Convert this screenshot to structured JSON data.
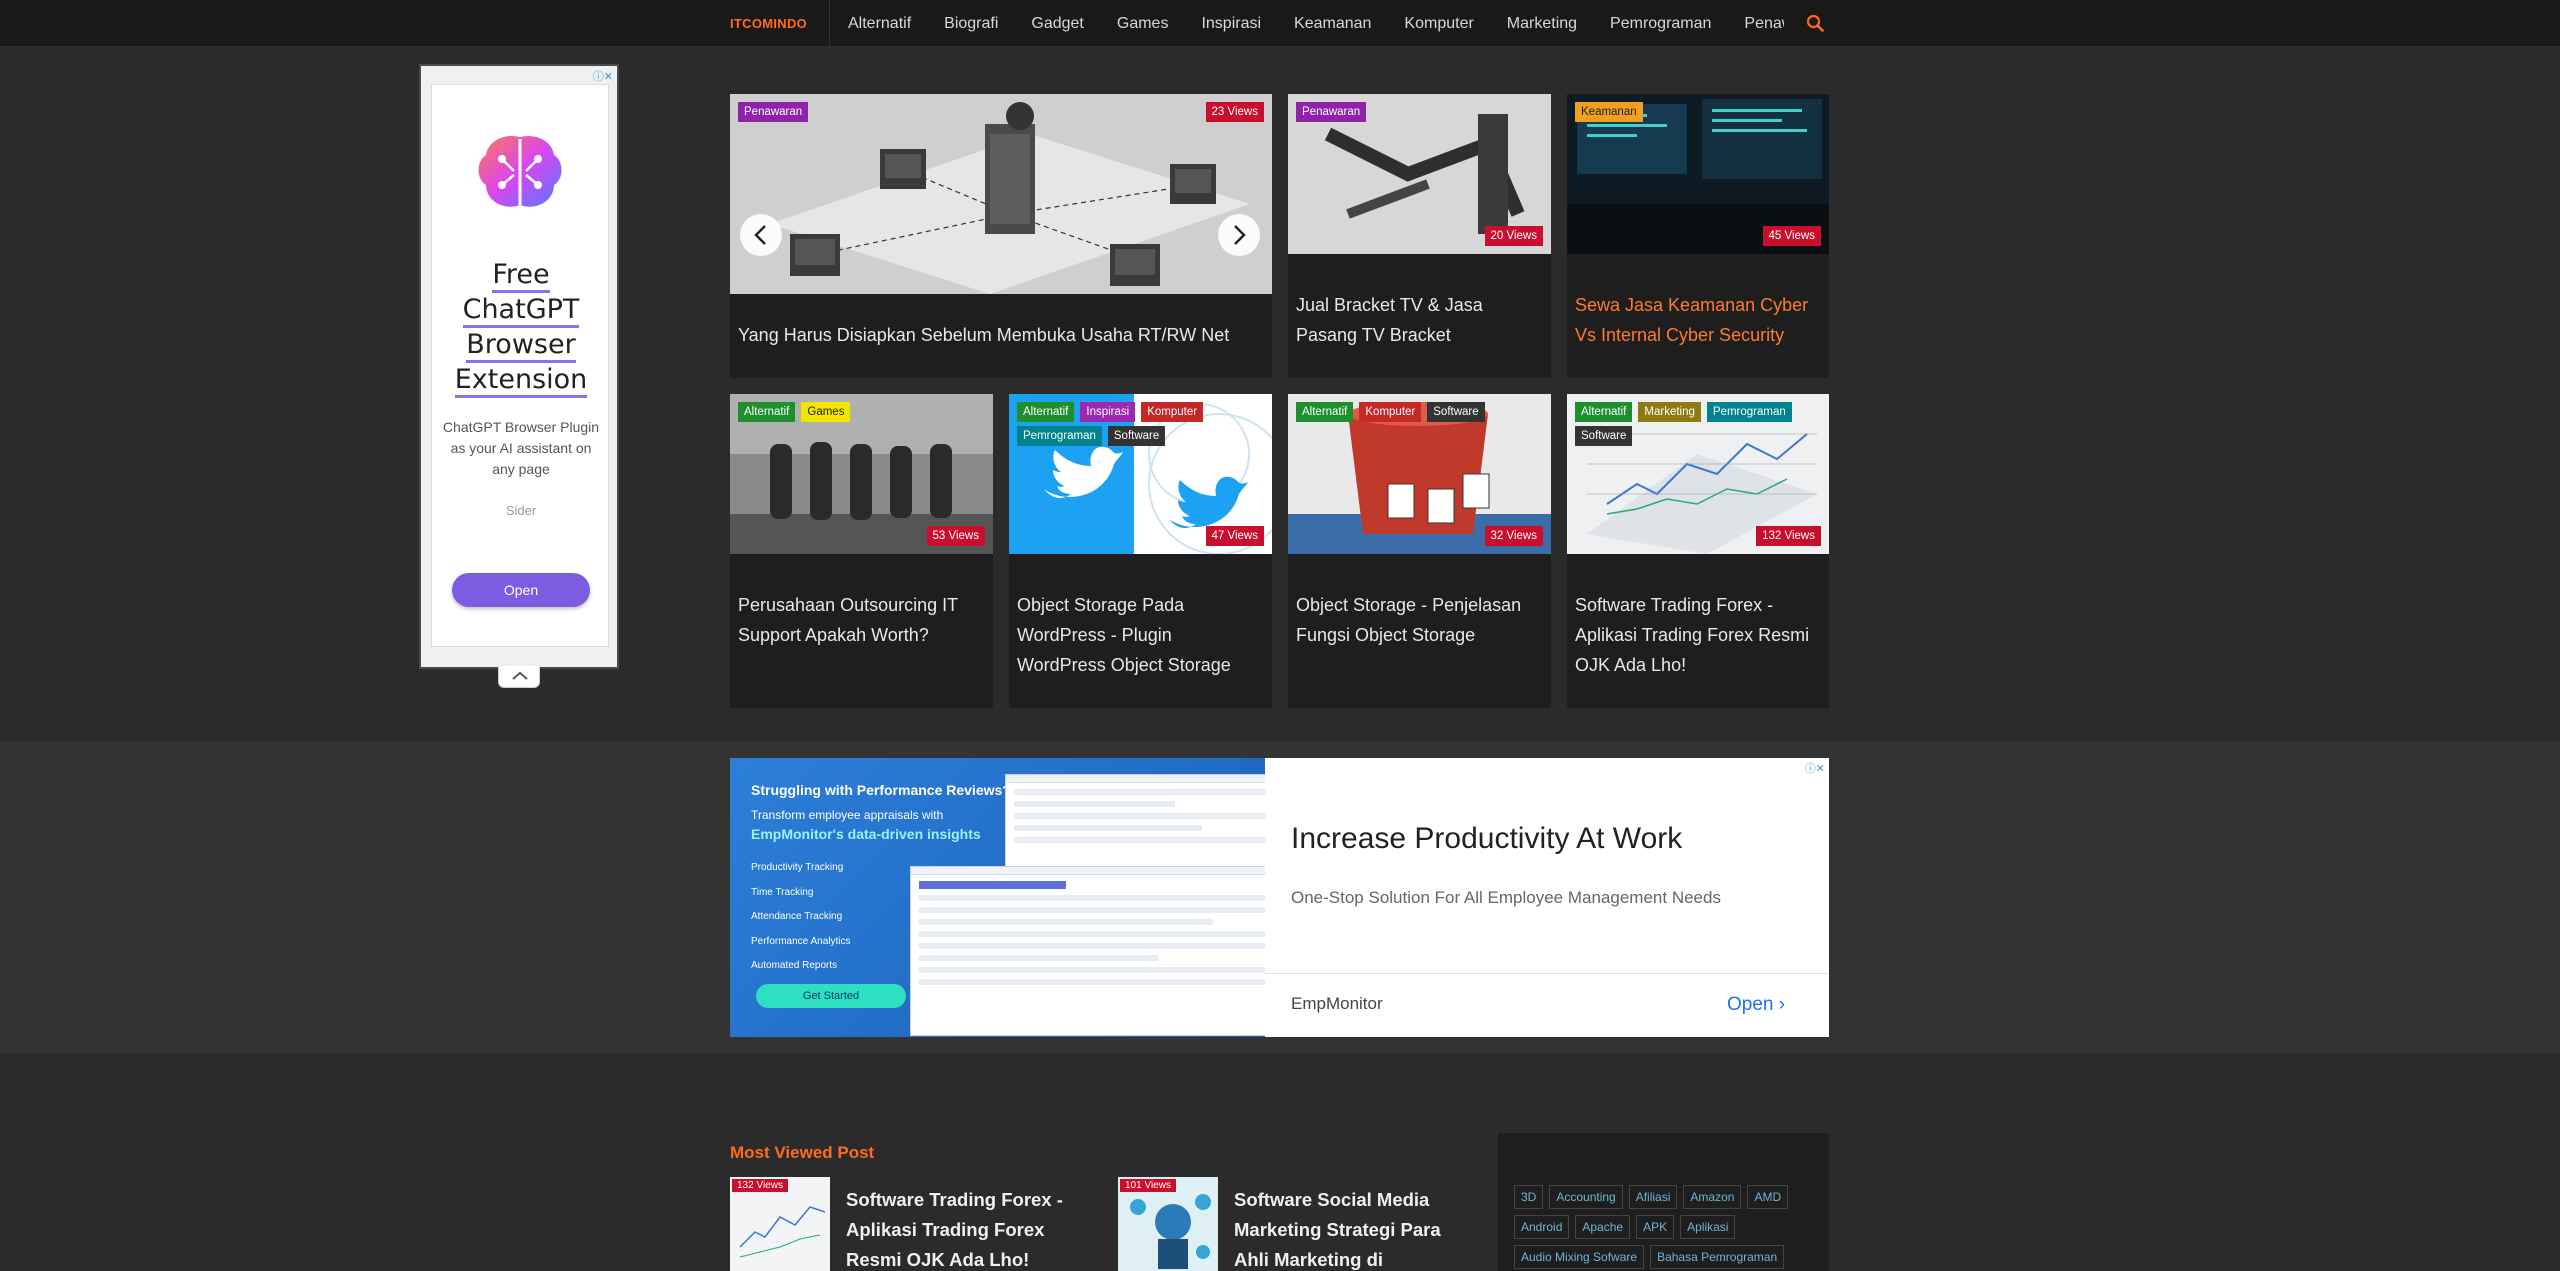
{
  "nav": {
    "brand": "ITCOMINDO",
    "items": [
      "Alternatif",
      "Biografi",
      "Gadget",
      "Games",
      "Inspirasi",
      "Keamanan",
      "Komputer",
      "Marketing",
      "Pemrograman",
      "Penaw"
    ],
    "search_icon": "search-icon"
  },
  "left_ad": {
    "title_lines": [
      "Free",
      "ChatGPT",
      "Browser",
      "Extension"
    ],
    "description": "ChatGPT Browser Plugin as your AI assistant on any page",
    "sponsor": "Sider",
    "cta": "Open"
  },
  "featured": {
    "title": "Yang Harus Disiapkan Sebelum Membuka Usaha RT/RW Net",
    "tag": "Penawaran",
    "views": "23 Views"
  },
  "cards": [
    {
      "title": "Jual Bracket TV & Jasa Pasang TV Bracket",
      "tags": [
        "Penawaran"
      ],
      "views": "20 Views"
    },
    {
      "title": "Sewa Jasa Keamanan Cyber Vs Internal Cyber Security",
      "tags": [
        "Keamanan"
      ],
      "views": "45 Views"
    },
    {
      "title": "Perusahaan Outsourcing IT Support Apakah Worth?",
      "tags": [
        "Alternatif",
        "Games"
      ],
      "views": "53 Views"
    },
    {
      "title": "Object Storage Pada WordPress - Plugin WordPress Object Storage",
      "tags": [
        "Alternatif",
        "Inspirasi",
        "Komputer",
        "Pemrograman",
        "Software"
      ],
      "views": "47 Views"
    },
    {
      "title": "Object Storage - Penjelasan Fungsi Object Storage",
      "tags": [
        "Alternatif",
        "Komputer",
        "Software"
      ],
      "views": "32 Views"
    },
    {
      "title": "Software Trading Forex - Aplikasi Trading Forex Resmi OJK Ada Lho!",
      "tags": [
        "Alternatif",
        "Marketing",
        "Pemrograman",
        "Software"
      ],
      "views": "132 Views"
    }
  ],
  "tag_colors": {
    "Penawaran": "#8e24aa",
    "Keamanan": "#f0a020",
    "Alternatif": "#1f8f2e",
    "Games": "#f2e600",
    "Inspirasi": "#9c27b0",
    "Komputer": "#c62828",
    "Pemrograman": "#00838f",
    "Software": "#333333",
    "Marketing": "#8d7b12"
  },
  "banner_ad": {
    "left_title": "Struggling with Performance Reviews?",
    "left_sub": "Transform employee appraisals with",
    "left_brand": "EmpMonitor's data-driven insights",
    "features": [
      "Productivity Tracking",
      "Time Tracking",
      "Attendance Tracking",
      "Performance Analytics",
      "Automated Reports"
    ],
    "left_cta": "Get Started",
    "headline": "Increase Productivity At Work",
    "description": "One-Stop Solution For All Employee Management Needs",
    "advertiser": "EmpMonitor",
    "open": "Open"
  },
  "most_viewed": {
    "heading": "Most Viewed Post",
    "posts": [
      {
        "views": "132 Views",
        "title": "Software Trading Forex - Aplikasi Trading Forex Resmi OJK Ada Lho!"
      },
      {
        "views": "101 Views",
        "title": "Software Social Media Marketing Strategi Para Ahli Marketing di Facebook..."
      }
    ]
  },
  "tag_cloud": [
    "3D",
    "Accounting",
    "Afiliasi",
    "Amazon",
    "AMD",
    "Android",
    "Apache",
    "APK",
    "Aplikasi",
    "Audio Mixing Sofware",
    "Bahasa Pemrograman"
  ]
}
